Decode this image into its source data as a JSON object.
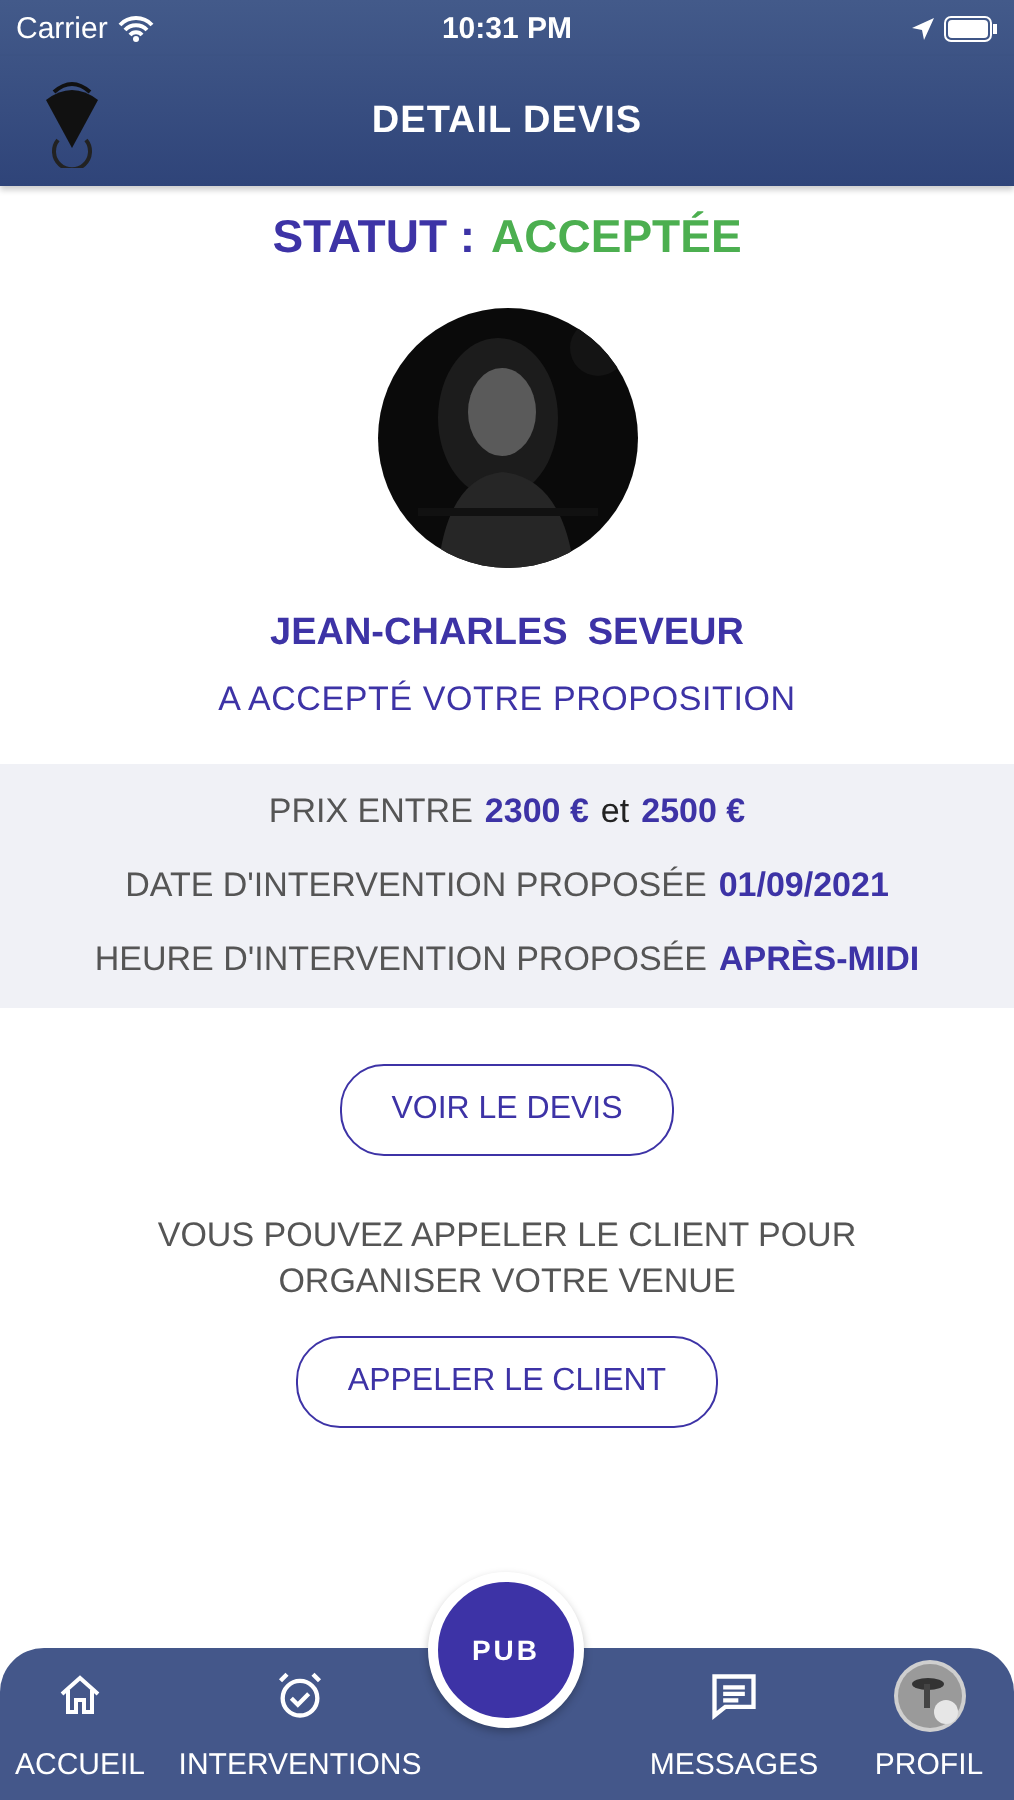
{
  "status_bar": {
    "carrier": "Carrier",
    "time": "10:31 PM"
  },
  "header": {
    "title": "DETAIL DEVIS"
  },
  "status": {
    "label": "STATUT :",
    "value": "ACCEPTÉE",
    "kind": "accepted"
  },
  "client": {
    "first_name": "JEAN-CHARLES",
    "last_name": "SEVEUR",
    "message": "A ACCEPTÉ VOTRE PROPOSITION"
  },
  "details": [
    {
      "kind": "range",
      "label": "PRIX ENTRE",
      "low": "2300 €",
      "joiner": "et",
      "high": "2500 €"
    },
    {
      "kind": "value",
      "label": "DATE D'INTERVENTION PROPOSÉE",
      "value": "01/09/2021"
    },
    {
      "kind": "value",
      "label": "HEURE D'INTERVENTION PROPOSÉE",
      "value": "APRÈS-MIDI"
    }
  ],
  "quote_button": "VOIR LE DEVIS",
  "call_info": "VOUS POUVEZ APPELER LE CLIENT POUR ORGANISER VOTRE VENUE",
  "call_button": "APPELER LE CLIENT",
  "pub_button": "PUB",
  "tab_bar": [
    {
      "kind": "home",
      "label": "ACCUEIL"
    },
    {
      "kind": "alarm",
      "label": "INTERVENTIONS"
    },
    {
      "kind": "messages",
      "label": "MESSAGES"
    },
    {
      "kind": "profile",
      "label": "PROFIL"
    }
  ]
}
